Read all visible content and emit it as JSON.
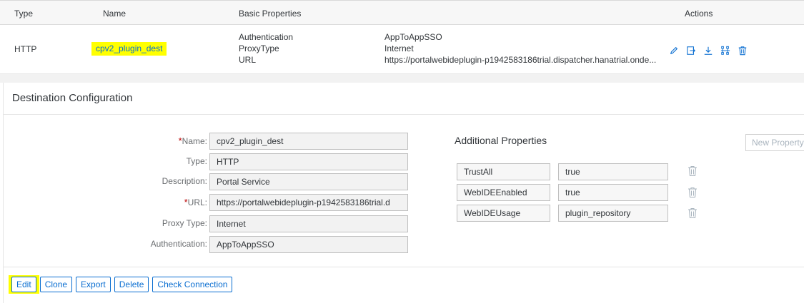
{
  "table": {
    "headers": {
      "type": "Type",
      "name": "Name",
      "basic_properties": "Basic Properties",
      "actions": "Actions"
    },
    "row": {
      "type": "HTTP",
      "name": "cpv2_plugin_dest",
      "properties": [
        {
          "key": "Authentication",
          "value": "AppToAppSSO"
        },
        {
          "key": "ProxyType",
          "value": "Internet"
        },
        {
          "key": "URL",
          "value": "https://portalwebideplugin-p1942583186trial.dispatcher.hanatrial.onde..."
        }
      ],
      "action_icons": [
        "edit-icon",
        "clone-icon",
        "export-icon",
        "check-connection-icon",
        "delete-icon"
      ]
    }
  },
  "config": {
    "title": "Destination Configuration",
    "fields": [
      {
        "label": "Name:",
        "required": true,
        "value": "cpv2_plugin_dest"
      },
      {
        "label": "Type:",
        "required": false,
        "value": "HTTP"
      },
      {
        "label": "Description:",
        "required": false,
        "value": "Portal Service"
      },
      {
        "label": "URL:",
        "required": true,
        "value": "https://portalwebideplugin-p1942583186trial.d"
      },
      {
        "label": "Proxy Type:",
        "required": false,
        "value": "Internet"
      },
      {
        "label": "Authentication:",
        "required": false,
        "value": "AppToAppSSO"
      }
    ],
    "required_marker": "*",
    "additional_properties": {
      "title": "Additional Properties",
      "new_property_label": "New Property",
      "items": [
        {
          "key": "TrustAll",
          "value": "true"
        },
        {
          "key": "WebIDEEnabled",
          "value": "true"
        },
        {
          "key": "WebIDEUsage",
          "value": "plugin_repository"
        }
      ]
    },
    "buttons": {
      "edit": "Edit",
      "clone": "Clone",
      "export": "Export",
      "delete": "Delete",
      "check_connection": "Check Connection"
    }
  },
  "colors": {
    "accent": "#0a6ed1",
    "highlight": "#ffff00",
    "required": "#bb0000"
  }
}
